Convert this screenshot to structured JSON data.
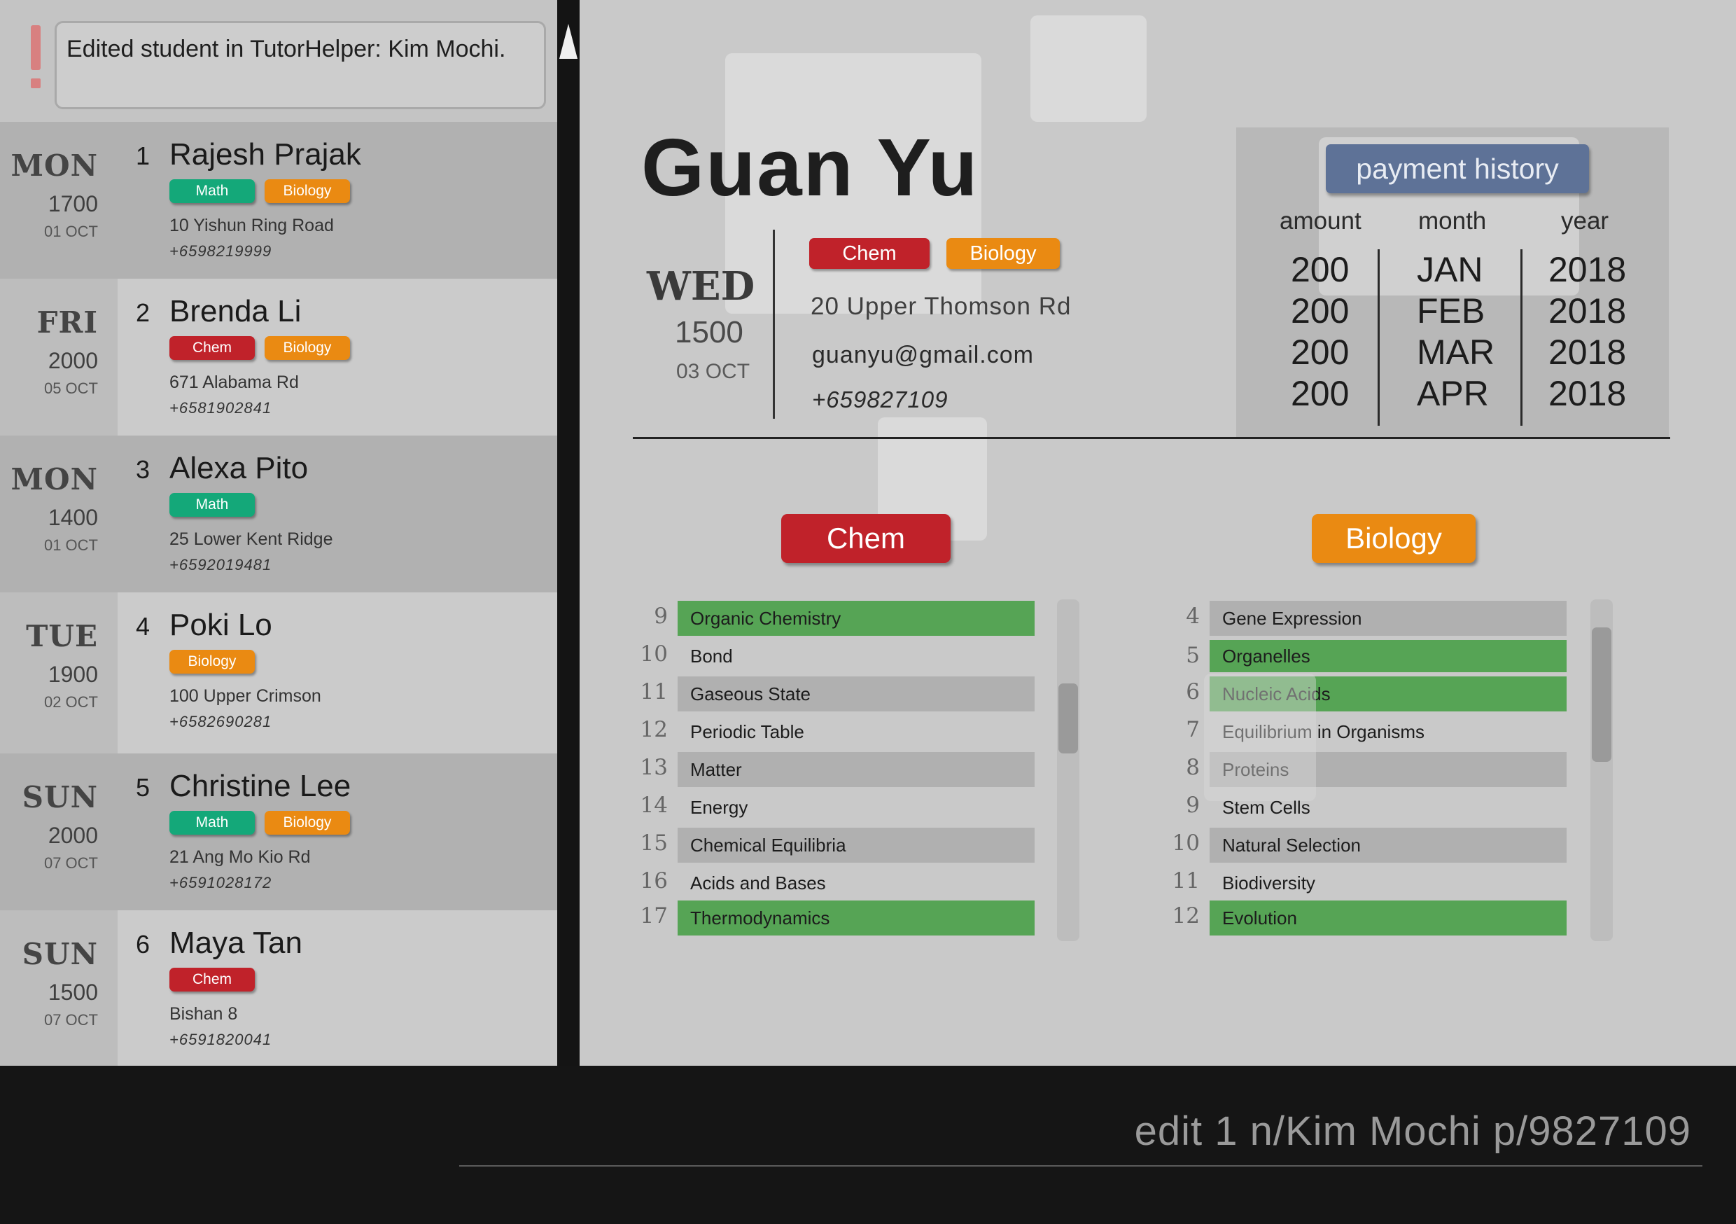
{
  "result": {
    "message": "Edited student in TutorHelper: Kim Mochi."
  },
  "students": [
    {
      "index": "1",
      "day": "MON",
      "time": "1700",
      "date": "01 OCT",
      "name": "Rajesh Prajak",
      "tags": [
        "Math",
        "Biology"
      ],
      "address": "10 Yishun Ring Road",
      "phone": "+6598219999"
    },
    {
      "index": "2",
      "day": "FRI",
      "time": "2000",
      "date": "05 OCT",
      "name": "Brenda Li",
      "tags": [
        "Chem",
        "Biology"
      ],
      "address": "671 Alabama Rd",
      "phone": "+6581902841"
    },
    {
      "index": "3",
      "day": "MON",
      "time": "1400",
      "date": "01 OCT",
      "name": "Alexa Pito",
      "tags": [
        "Math"
      ],
      "address": "25 Lower Kent Ridge",
      "phone": "+6592019481"
    },
    {
      "index": "4",
      "day": "TUE",
      "time": "1900",
      "date": "02 OCT",
      "name": "Poki Lo",
      "tags": [
        "Biology"
      ],
      "address": "100 Upper Crimson",
      "phone": "+6582690281"
    },
    {
      "index": "5",
      "day": "SUN",
      "time": "2000",
      "date": "07 OCT",
      "name": "Christine Lee",
      "tags": [
        "Math",
        "Biology"
      ],
      "address": "21 Ang Mo Kio Rd",
      "phone": "+6591028172"
    },
    {
      "index": "6",
      "day": "SUN",
      "time": "1500",
      "date": "07 OCT",
      "name": "Maya Tan",
      "tags": [
        "Chem"
      ],
      "address": "Bishan 8",
      "phone": "+6591820041"
    }
  ],
  "detail": {
    "name": "Guan Yu",
    "day": "WED",
    "time": "1500",
    "date": "03 OCT",
    "tags": [
      "Chem",
      "Biology"
    ],
    "address": "20 Upper Thomson Rd",
    "email": "guanyu@gmail.com",
    "phone": "+659827109"
  },
  "payment": {
    "button_label": "payment history",
    "headers": {
      "amount": "amount",
      "month": "month",
      "year": "year"
    },
    "amounts": [
      "200",
      "200",
      "200",
      "200"
    ],
    "months": [
      "JAN",
      "FEB",
      "MAR",
      "APR"
    ],
    "years": [
      "2018",
      "2018",
      "2018",
      "2018"
    ]
  },
  "subjects": {
    "chem": {
      "label": "Chem",
      "topics": [
        {
          "num": "9",
          "name": "Organic Chemistry",
          "state": "green"
        },
        {
          "num": "10",
          "name": "Bond",
          "state": "none"
        },
        {
          "num": "11",
          "name": "Gaseous State",
          "state": "grey"
        },
        {
          "num": "12",
          "name": "Periodic Table",
          "state": "none"
        },
        {
          "num": "13",
          "name": "Matter",
          "state": "grey"
        },
        {
          "num": "14",
          "name": "Energy",
          "state": "none"
        },
        {
          "num": "15",
          "name": "Chemical Equilibria",
          "state": "grey"
        },
        {
          "num": "16",
          "name": "Acids and Bases",
          "state": "none"
        },
        {
          "num": "17",
          "name": "Thermodynamics",
          "state": "green"
        }
      ]
    },
    "biology": {
      "label": "Biology",
      "topics": [
        {
          "num": "4",
          "name": "Gene Expression",
          "state": "grey"
        },
        {
          "num": "5",
          "name": "Organelles",
          "state": "green"
        },
        {
          "num": "6",
          "name": "Nucleic Acids",
          "state": "green"
        },
        {
          "num": "7",
          "name": "Equilibrium in Organisms",
          "state": "none"
        },
        {
          "num": "8",
          "name": "Proteins",
          "state": "grey"
        },
        {
          "num": "9",
          "name": "Stem Cells",
          "state": "none"
        },
        {
          "num": "10",
          "name": "Natural Selection",
          "state": "grey"
        },
        {
          "num": "11",
          "name": "Biodiversity",
          "state": "none"
        },
        {
          "num": "12",
          "name": "Evolution",
          "state": "green"
        }
      ]
    }
  },
  "command": {
    "value": "edit 1 n/Kim Mochi p/9827109"
  },
  "colors": {
    "math": "#14a879",
    "biology": "#ea8a12",
    "chem": "#c0222a",
    "payment_button": "#5e7297",
    "topic_done": "#56a455",
    "alert": "#d88080"
  },
  "icons": {
    "alert": "exclamation-icon",
    "scroll_up": "scroll-up-arrow-icon"
  }
}
